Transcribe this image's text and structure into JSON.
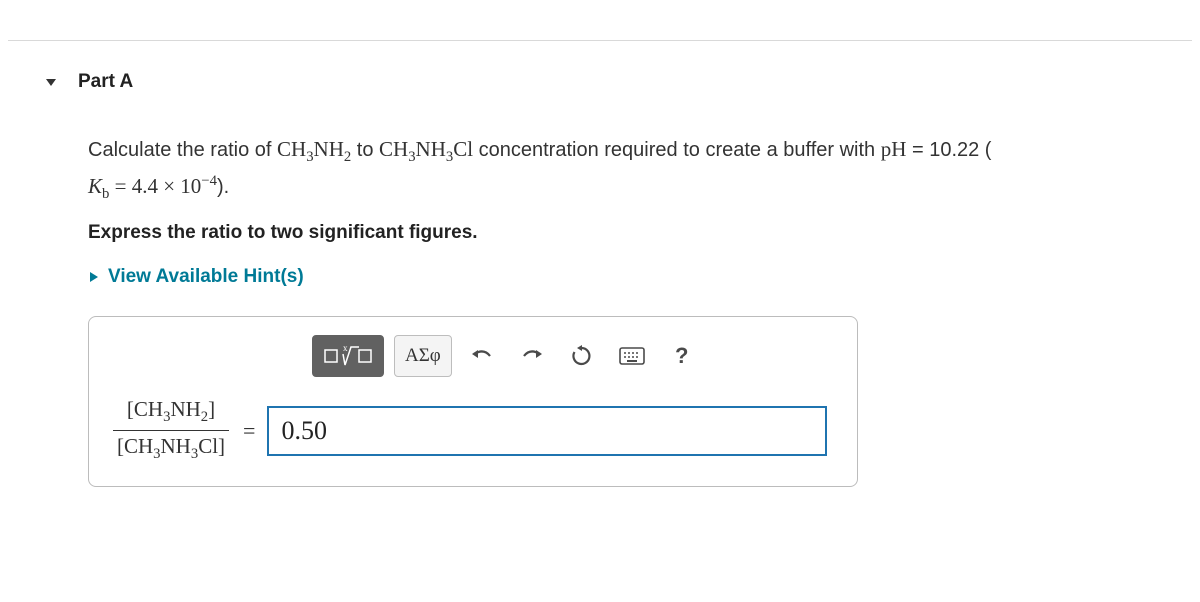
{
  "part": {
    "label": "Part A"
  },
  "question": {
    "lead": "Calculate the ratio of ",
    "species1": "CH3NH2",
    "mid1": " to ",
    "species2": "CH3NH3Cl",
    "mid2": " concentration required to create a buffer with ",
    "ph_symbol": "pH",
    "ph_eq": " = 10.22 (",
    "kb_symbol": "K_b",
    "kb_eq": " = 4.4 × 10",
    "kb_exp": "−4",
    "tail": ")."
  },
  "instruction": "Express the ratio to two significant figures.",
  "hint_link": "View Available Hint(s)",
  "toolbar": {
    "greek_label": "ΑΣφ",
    "help_label": "?"
  },
  "ratio": {
    "numerator": "[CH3NH2]",
    "denominator": "[CH3NH3Cl]"
  },
  "equals": "=",
  "answer_value": "0.50"
}
